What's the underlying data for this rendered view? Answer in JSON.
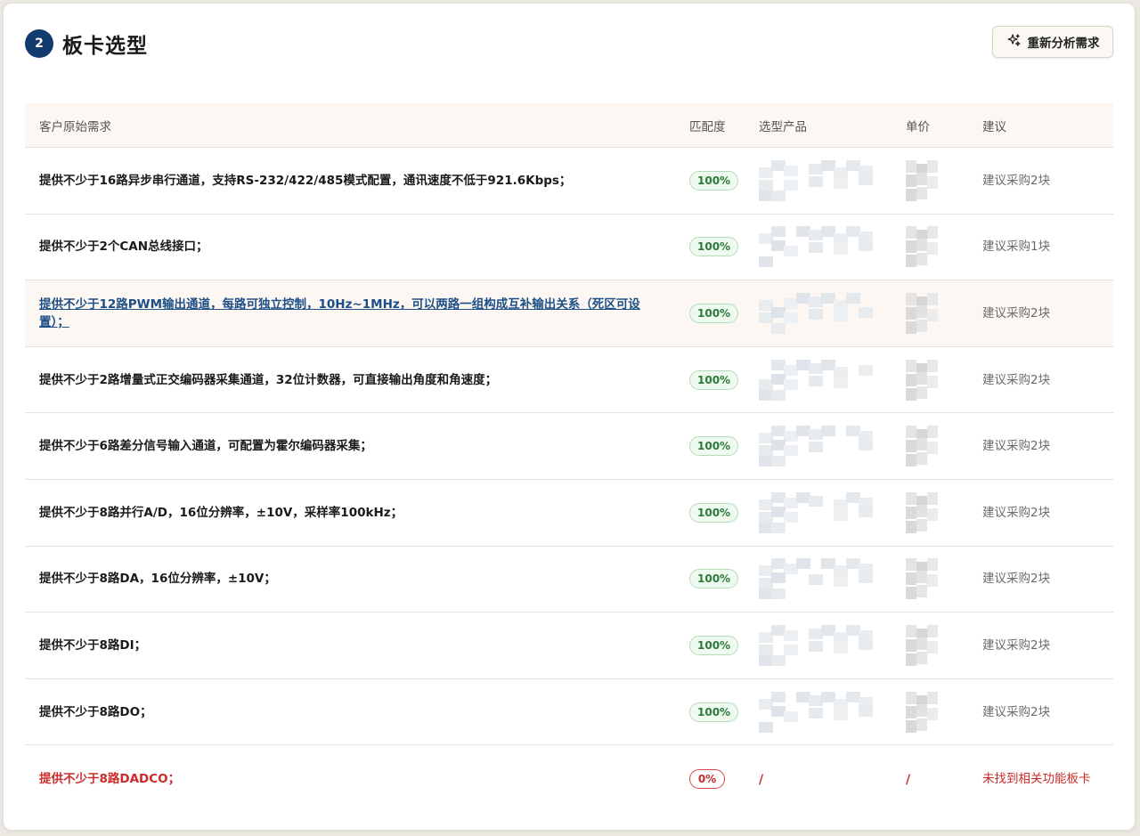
{
  "header": {
    "step": "2",
    "title": "板卡选型",
    "reanalyze_label": "重新分析需求"
  },
  "table": {
    "columns": [
      "客户原始需求",
      "匹配度",
      "选型产品",
      "单价",
      "建议"
    ],
    "rows": [
      {
        "requirement": "提供不少于16路异步串行通道，支持RS-232/422/485模式配置，通讯速度不低于921.6Kbps；",
        "match": "100%",
        "suggestion": "建议采购2块"
      },
      {
        "requirement": "提供不少于2个CAN总线接口；",
        "match": "100%",
        "suggestion": "建议采购1块"
      },
      {
        "requirement": "提供不少于12路PWM输出通道，每路可独立控制，10Hz~1MHz，可以两路一组构成互补输出关系（死区可设置）；",
        "match": "100%",
        "suggestion": "建议采购2块"
      },
      {
        "requirement": "提供不少于2路增量式正交编码器采集通道，32位计数器，可直接输出角度和角速度；",
        "match": "100%",
        "suggestion": "建议采购2块"
      },
      {
        "requirement": "提供不少于6路差分信号输入通道，可配置为霍尔编码器采集；",
        "match": "100%",
        "suggestion": "建议采购2块"
      },
      {
        "requirement": "提供不少于8路并行A/D，16位分辨率，±10V，采样率100kHz；",
        "match": "100%",
        "suggestion": "建议采购2块"
      },
      {
        "requirement": "提供不少于8路DA，16位分辨率，±10V；",
        "match": "100%",
        "suggestion": "建议采购2块"
      },
      {
        "requirement": "提供不少于8路DI；",
        "match": "100%",
        "suggestion": "建议采购2块"
      },
      {
        "requirement": "提供不少于8路DO；",
        "match": "100%",
        "suggestion": "建议采购2块"
      },
      {
        "requirement": "提供不少于8路DADCO；",
        "match": "0%",
        "product": "/",
        "price": "/",
        "suggestion": "未找到相关功能板卡"
      }
    ]
  },
  "icons": {
    "reanalyze": "sparkle-icon"
  },
  "colors": {
    "accent": "#123c6e",
    "match_ok": "#2b7a37",
    "error": "#cc2b2b",
    "link": "#1d4f86"
  }
}
